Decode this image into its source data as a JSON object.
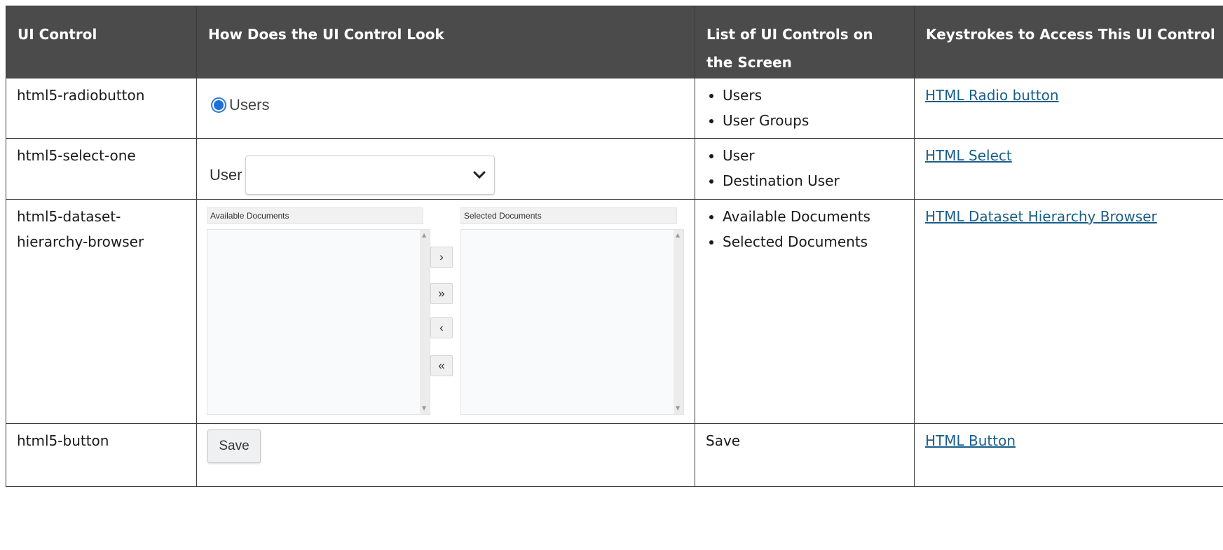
{
  "headers": [
    "UI Control",
    "How Does the UI Control Look",
    "List of UI Controls on the Screen",
    "Keystrokes to Access This UI Control"
  ],
  "rows": [
    {
      "control": "html5-radiobutton",
      "preview": {
        "radio_label": "Users",
        "radio_checked": true
      },
      "controls_list": [
        "Users",
        "User Groups"
      ],
      "link": "HTML Radio button"
    },
    {
      "control": "html5-select-one",
      "preview": {
        "select_label": "User",
        "select_value": ""
      },
      "controls_list": [
        "User",
        "Destination User"
      ],
      "link": "HTML Select"
    },
    {
      "control": "html5-dataset-hierarchy-browser",
      "preview": {
        "available_header": "Available Documents",
        "selected_header": "Selected Documents",
        "move_right": "›",
        "move_all_right": "»",
        "move_left": "‹",
        "move_all_left": "«"
      },
      "controls_list": [
        "Available Documents",
        "Selected Documents"
      ],
      "link": "HTML Dataset Hierarchy Browser"
    },
    {
      "control": "html5-button",
      "preview": {
        "button_label": "Save"
      },
      "controls_text": "Save",
      "link": "HTML Button"
    }
  ],
  "colors": {
    "header_bg": "#4b4b4b",
    "link": "#1a5e8a",
    "radio_accent": "#1e6fd9"
  }
}
